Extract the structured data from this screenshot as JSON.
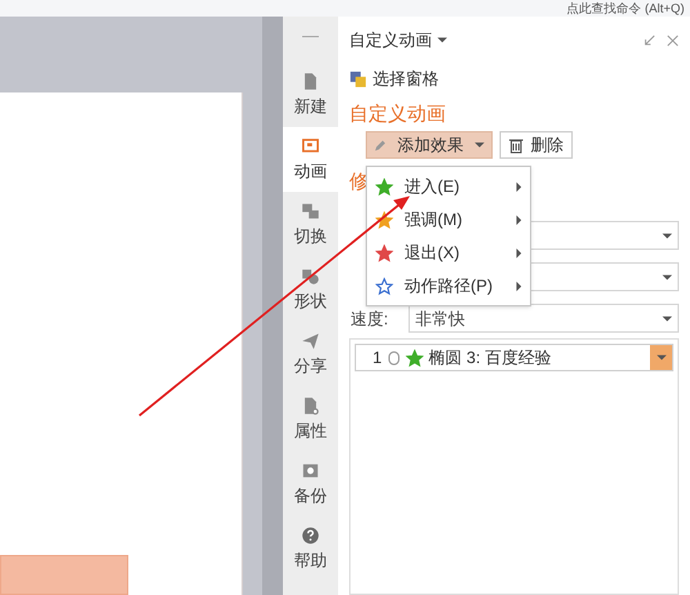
{
  "top_bar": {
    "search_hint": "点此查找命令 (Alt+Q)"
  },
  "side_tabs": [
    {
      "label": "新建",
      "selected": false
    },
    {
      "label": "动画",
      "selected": true
    },
    {
      "label": "切换",
      "selected": false
    },
    {
      "label": "形状",
      "selected": false
    },
    {
      "label": "分享",
      "selected": false
    },
    {
      "label": "属性",
      "selected": false
    },
    {
      "label": "备份",
      "selected": false
    },
    {
      "label": "帮助",
      "selected": false
    }
  ],
  "panel": {
    "title": "自定义动画",
    "select_pane": "选择窗格",
    "heading": "自定义动画",
    "add_button": "添加效果",
    "delete_button": "删除",
    "modify_heading": "修",
    "speed_label": "速度:",
    "speed_value": "非常快"
  },
  "menu": [
    {
      "label": "进入(E)",
      "color": "#3fae2a"
    },
    {
      "label": "强调(M)",
      "color": "#f0a020"
    },
    {
      "label": "退出(X)",
      "color": "#e04848"
    },
    {
      "label": "动作路径(P)",
      "color": "#3a6fd0"
    }
  ],
  "effects": [
    {
      "number": "1",
      "name": "椭圆 3: 百度经验",
      "selected": true
    }
  ]
}
